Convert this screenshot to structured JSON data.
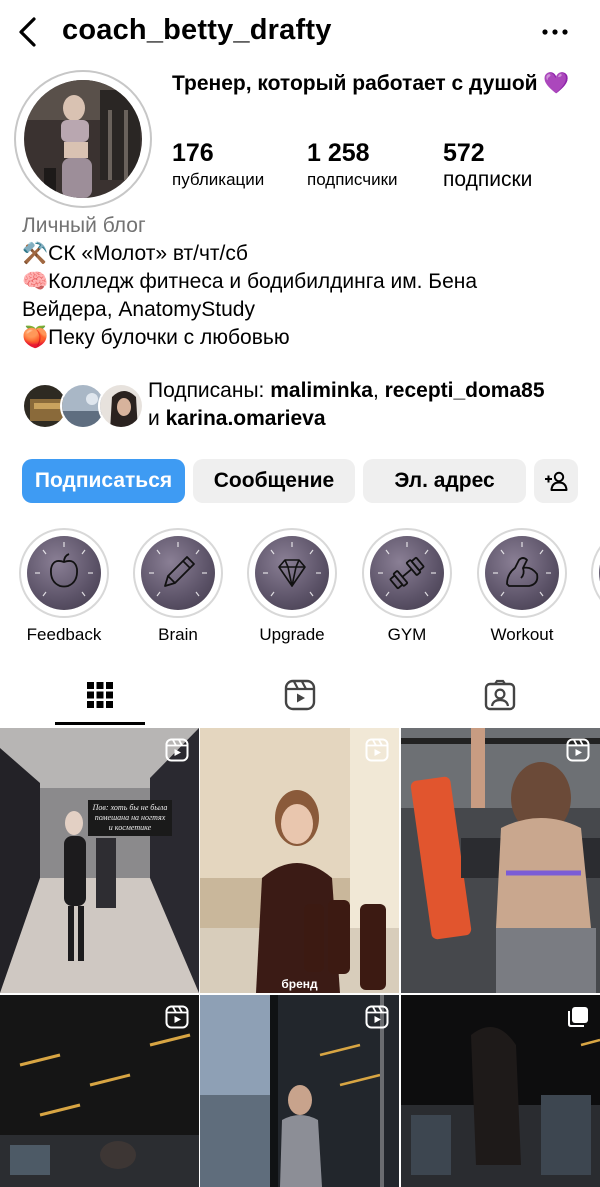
{
  "header": {
    "username": "coach_betty_drafty"
  },
  "profile": {
    "tagline": "Тренер, который работает с душой 💜",
    "stats": [
      {
        "value": "176",
        "label": "публикации"
      },
      {
        "value": "1 258",
        "label": "подписчики"
      },
      {
        "value": "572",
        "label": "подписки"
      }
    ],
    "category": "Личный блог",
    "bio_lines": [
      "⚒️СК «Молот» вт/чт/сб",
      "🧠Колледж фитнеса и бодибилдинга им. Бена",
      "Вейдера, AnatomyStudy",
      "🍑Пеку булочки с любовью"
    ],
    "followed_by": {
      "prefix": "Подписаны: ",
      "user1": "maliminka",
      "sep": ", ",
      "user2": "recepti_doma85",
      "and": "и ",
      "user3": "karina.omarieva"
    }
  },
  "actions": {
    "follow": "Подписаться",
    "message": "Сообщение",
    "email": "Эл. адрес"
  },
  "highlights": [
    {
      "label": "Feedback",
      "icon": "apple-icon"
    },
    {
      "label": "Brain",
      "icon": "pencil-icon"
    },
    {
      "label": "Upgrade",
      "icon": "diamond-icon"
    },
    {
      "label": "GYM",
      "icon": "dumbbell-icon"
    },
    {
      "label": "Workout",
      "icon": "flexed-arm-icon"
    }
  ],
  "tabs": [
    "grid-icon",
    "reels-icon",
    "tagged-icon"
  ],
  "posts": [
    {
      "type": "reel",
      "caption": "Пов: хоть бы не была помешана на ногтях и косметике"
    },
    {
      "type": "reel",
      "caption": "бренд"
    },
    {
      "type": "reel",
      "caption": ""
    },
    {
      "type": "reel",
      "caption": ""
    },
    {
      "type": "reel",
      "caption": ""
    },
    {
      "type": "carousel",
      "caption": ""
    }
  ],
  "colors": {
    "primary": "#3e9bf3",
    "button_bg": "#efefef",
    "secondary_text": "#737373"
  }
}
